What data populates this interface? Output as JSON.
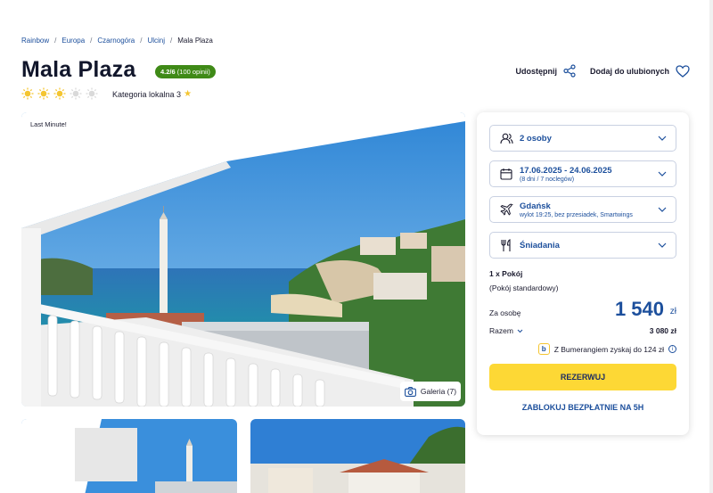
{
  "breadcrumb": [
    "Rainbow",
    "Europa",
    "Czarnogóra",
    "Ulcinj",
    "Mala Plaza"
  ],
  "hotel": {
    "name": "Mala Plaza",
    "rating": "4.2/6",
    "reviews": "(100 opinii)",
    "suns_total": 5,
    "suns_filled": 3,
    "category_label": "Kategoria lokalna 3"
  },
  "actions": {
    "share": "Udostępnij",
    "favorite": "Dodaj do ulubionych"
  },
  "gallery": {
    "badge": "Last Minute!",
    "button": "Galeria (7)"
  },
  "booking": {
    "persons": "2 osoby",
    "dates": "17.06.2025 - 24.06.2025",
    "nights": "(8 dni / 7 noclegów)",
    "departure_city": "Gdańsk",
    "flight_info": "wylot 19:25, bez przesiadek, Smartwings",
    "board": "Śniadania",
    "room_count": "1 x Pokój",
    "room_type": "(Pokój standardowy)",
    "per_person_label": "Za osobę",
    "price": "1 540",
    "currency": "zł",
    "total_label": "Razem",
    "total": "3 080 zł",
    "bumerang": "Z Bumerangiem zyskaj do 124 zł",
    "reserve": "REZERWUJ",
    "lock": "ZABLOKUJ BEZPŁATNIE NA 5H"
  },
  "colors": {
    "brand_blue": "#1c4f9c",
    "rating_green": "#3f8a17",
    "cta_yellow": "#fdd835",
    "sun_yellow": "#f4c531"
  }
}
